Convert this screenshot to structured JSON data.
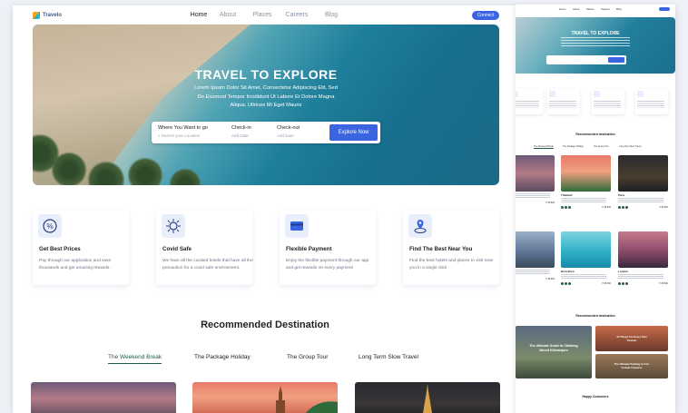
{
  "nav": {
    "logo_text": "Travelo",
    "links": [
      "Home",
      "About",
      "Places",
      "Careers",
      "Blog"
    ],
    "active_link": "Home",
    "connect_label": "Connect"
  },
  "hero": {
    "title": "TRAVEL TO EXPLORE",
    "subtitle": "Lorem Ipsum Dolor Sit Amet, Consectetur Adipiscing Elit, Sed Do Eiusmod Tempor Incididunt Ut Labore Et Dolore Magna Aliqua. Ultrices Mi Eget Mauris",
    "search": {
      "where_label": "Where You Want to go",
      "where_placeholder": "Search your Location",
      "checkin_label": "Check-in",
      "checkin_value": "Add Date",
      "checkout_label": "Check-out",
      "checkout_value": "Add Date",
      "button_label": "Explore Now"
    }
  },
  "features": [
    {
      "icon": "percent-badge-icon",
      "title": "Get Best Prices",
      "desc": "Pay through our application and save thousands and get amazing rewards."
    },
    {
      "icon": "virus-shield-icon",
      "title": "Covid Safe",
      "desc": "We have all the curated hotels that have all the precaution for a covid safe environment."
    },
    {
      "icon": "credit-card-icon",
      "title": "Flexible Payment",
      "desc": "Enjoy the flexible payment through our app and get rewards on every payment"
    },
    {
      "icon": "location-pin-icon",
      "title": "Find The Best Near You",
      "desc": "Find the best hotels and places to visit near you in a single click"
    }
  ],
  "recommended": {
    "title": "Recommended Destination",
    "tabs": [
      "The Weekend Break",
      "The Package Holiday",
      "The Group Tour",
      "Long Term Slow Travel"
    ],
    "active_tab": "The Weekend Break"
  },
  "side_preview": {
    "nav": [
      "Home",
      "About",
      "Places",
      "Careers",
      "Blog"
    ],
    "hero_title": "TRAVEL TO EXPLORE",
    "recommended_title": "Recommended destination",
    "tabs": [
      "The Weekend Break",
      "The Package Holiday",
      "The Group Tour",
      "Long Term Slow Travel"
    ],
    "cards": [
      {
        "name": "",
        "price": "₹ 38,800"
      },
      {
        "name": "Thailand",
        "price": "₹ 38,800"
      },
      {
        "name": "Paris",
        "price": "₹ 38,800"
      },
      {
        "name": "",
        "price": "₹ 38,800"
      },
      {
        "name": "Bora Bora",
        "price": "₹ 38,800"
      },
      {
        "name": "London",
        "price": "₹ 38,800"
      }
    ],
    "recommended_title_2": "Recommended destination",
    "blog_main": "The Ultimate Guide to Climbing Mount Kilimanjaro",
    "blog_side_1": "10 Things For Every Solo Traveler",
    "blog_side_2": "The Ultimate Packing List for Female Travelers",
    "happy_customers": "Happy Customers"
  },
  "colors": {
    "accent": "#3b64e0",
    "tab_active": "#1c5a44",
    "background": "#eef1f7"
  }
}
